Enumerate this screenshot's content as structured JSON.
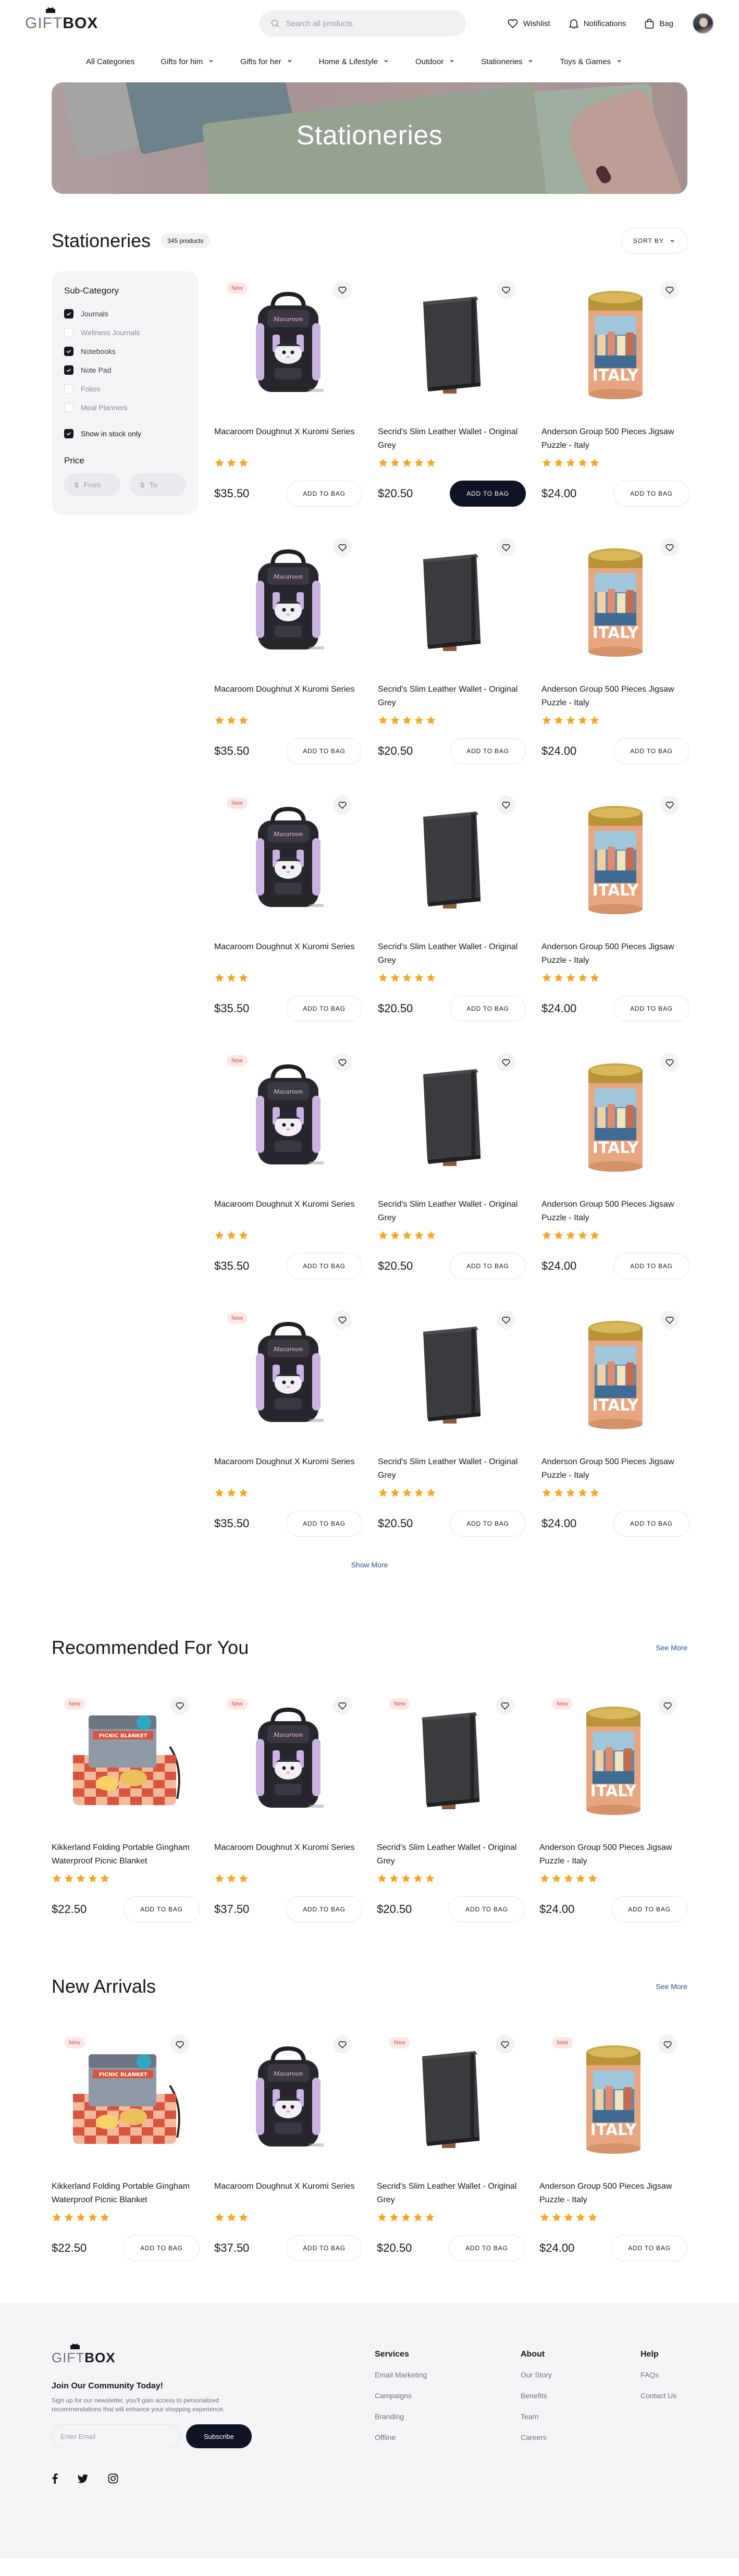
{
  "header": {
    "logo_gift": "GIFT",
    "logo_box": "BOX",
    "search_placeholder": "Search all products",
    "wishlist": "Wishlist",
    "notifications": "Notifications",
    "bag": "Bag"
  },
  "nav": [
    {
      "label": "All Categories",
      "has_chevron": false
    },
    {
      "label": "Gifts for him",
      "has_chevron": true
    },
    {
      "label": "Gifts for her",
      "has_chevron": true
    },
    {
      "label": "Home & Lifestyle",
      "has_chevron": true
    },
    {
      "label": "Outdoor",
      "has_chevron": true
    },
    {
      "label": "Stationeries",
      "has_chevron": true
    },
    {
      "label": "Toys & Games",
      "has_chevron": true
    }
  ],
  "hero": {
    "title": "Stationeries"
  },
  "listing": {
    "title": "Stationeries",
    "count": "345 products",
    "sort_label": "SORT BY"
  },
  "filter": {
    "subcategory_title": "Sub-Category",
    "options": [
      {
        "label": "Journals",
        "checked": true
      },
      {
        "label": "Wellness Journals",
        "checked": false
      },
      {
        "label": "Notebooks",
        "checked": true
      },
      {
        "label": "Note Pad",
        "checked": true
      },
      {
        "label": "Folios",
        "checked": false
      },
      {
        "label": "Meal Planners",
        "checked": false
      }
    ],
    "in_stock_label": "Show in stock only",
    "in_stock_checked": true,
    "price_title": "Price",
    "price_from_placeholder": "From",
    "price_to_placeholder": "To",
    "currency_symbol": "$"
  },
  "products": {
    "bag": {
      "title": "Macaroom Doughnut X Kuromi Series",
      "price": "$35.50",
      "rating": 3,
      "kind": "bag"
    },
    "wallet": {
      "title": "Secrid's Slim Leather Wallet - Original Grey",
      "price": "$20.50",
      "rating": 5,
      "kind": "wallet"
    },
    "puzzle": {
      "title": "Anderson Group 500 Pieces Jigsaw Puzzle - Italy",
      "price": "$24.00",
      "rating": 5,
      "kind": "tube"
    },
    "blanket": {
      "title": "Kikkerland Folding Portable Gingham Waterproof Picnic Blanket",
      "price": "$22.50",
      "rating": 5,
      "kind": "blanket"
    },
    "bag_alt": {
      "title": "Macaroom Doughnut X Kuromi Series",
      "price": "$37.50",
      "rating": 3,
      "kind": "bag"
    }
  },
  "grid_rows": [
    [
      {
        "ref": "bag",
        "new": true
      },
      {
        "ref": "wallet",
        "new": false,
        "dark_button": true
      },
      {
        "ref": "puzzle",
        "new": false
      }
    ],
    [
      {
        "ref": "bag",
        "new": false
      },
      {
        "ref": "wallet",
        "new": false
      },
      {
        "ref": "puzzle",
        "new": false
      }
    ],
    [
      {
        "ref": "bag",
        "new": true
      },
      {
        "ref": "wallet",
        "new": false
      },
      {
        "ref": "puzzle",
        "new": false
      }
    ],
    [
      {
        "ref": "bag",
        "new": true
      },
      {
        "ref": "wallet",
        "new": false
      },
      {
        "ref": "puzzle",
        "new": false
      }
    ],
    [
      {
        "ref": "bag",
        "new": true
      },
      {
        "ref": "wallet",
        "new": false
      },
      {
        "ref": "puzzle",
        "new": false
      }
    ]
  ],
  "add_to_bag_label": "ADD TO BAG",
  "new_label": "New",
  "show_more": "Show More",
  "recommended": {
    "title": "Recommended For You",
    "see_more": "See More",
    "items": [
      {
        "ref": "blanket",
        "new": true
      },
      {
        "ref": "bag_alt",
        "new": true
      },
      {
        "ref": "wallet",
        "new": true
      },
      {
        "ref": "puzzle",
        "new": true
      }
    ]
  },
  "new_arrivals": {
    "title": "New Arrivals",
    "see_more": "See More",
    "items": [
      {
        "ref": "blanket",
        "new": true
      },
      {
        "ref": "bag_alt",
        "new": false
      },
      {
        "ref": "wallet",
        "new": true
      },
      {
        "ref": "puzzle",
        "new": true
      }
    ]
  },
  "footer": {
    "join_title": "Join Our Community Today!",
    "join_desc": "Sign up for our newsletter, you'll gain access to personalized recommendations that will enhance your shopping experience.",
    "email_placeholder": "Enter Email",
    "subscribe": "Subscribe",
    "columns": [
      {
        "title": "Services",
        "links": [
          "Email Marketing",
          "Campaigns",
          "Branding",
          "Offline"
        ]
      },
      {
        "title": "About",
        "links": [
          "Our Story",
          "Benefits",
          "Team",
          "Careers"
        ]
      },
      {
        "title": "Help",
        "links": [
          "FAQs",
          "Contact Us"
        ]
      }
    ]
  },
  "colors": {
    "accent_dark": "#0f1424",
    "star": "#f5a623",
    "link": "#2d4a93",
    "new_badge": "#d1544a"
  }
}
